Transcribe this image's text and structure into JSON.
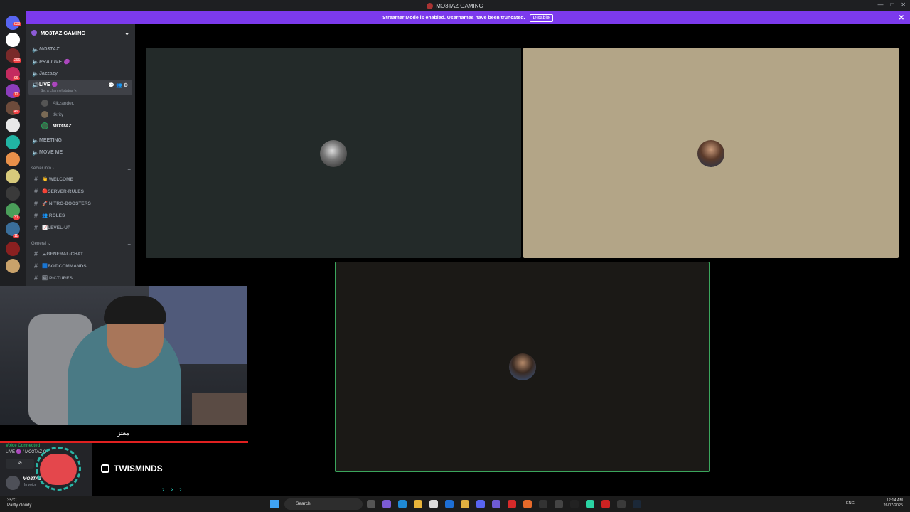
{
  "window": {
    "title": "MO3TAZ GAMING",
    "controls": [
      "—",
      "□",
      "✕"
    ]
  },
  "streamer_banner": {
    "text": "Streamer Mode is enabled. Usernames have been truncated.",
    "button": "Disable",
    "close": "✕"
  },
  "server_rail": {
    "badges": [
      "838",
      "296",
      "96",
      "12",
      "49",
      "31",
      "11"
    ],
    "colors": [
      "#5865f2",
      "#ffffff",
      "#c42b5f",
      "#8b3dbb",
      "#6d4b3b",
      "#e8e8e8",
      "#21b4a4",
      "#e9904a",
      "#d7c97b",
      "#3a3a3a",
      "#4a9e5a",
      "#3a6e9a",
      "#8a2020",
      "#c9a26b"
    ]
  },
  "sidebar": {
    "guild_name": "MO3TAZ GAMING",
    "voice_channels": [
      {
        "label": "MO3TAZ"
      },
      {
        "label": "PRA LIVE 🟣"
      },
      {
        "label": "Jazzazy"
      },
      {
        "label": "LIVE 🟣",
        "status": "Set a channel status ✎"
      },
      {
        "label": "MEETING"
      },
      {
        "label": "MOVE ME"
      }
    ],
    "live_members": [
      "Alkzander.",
      "tlkrity",
      "MO3TAZ"
    ],
    "categories": [
      {
        "label": "server info ›",
        "channels": [
          "👋 WELCOME",
          "🔴SERVER-RULES",
          "🚀 NITRO-BOOSTERS",
          "👥 ROLES",
          "📈LEVEL-UP"
        ]
      },
      {
        "label": "General ⌄",
        "channels": [
          "☁GENERAL-CHAT",
          "🟦BOT-COMMANDS",
          "🖼 PICTURES"
        ]
      }
    ]
  },
  "stage": {
    "tiles": [
      {
        "bg": "#232a29",
        "border": "#232a29"
      },
      {
        "bg": "#b3a587",
        "border": "#b3a587"
      },
      {
        "bg": "#1b1916",
        "border": "#3ba55c"
      }
    ]
  },
  "overlay": {
    "caption": "معتز",
    "social_handle": "TWISMINDS",
    "chevrons": "› › ›"
  },
  "voice_panel": {
    "status": "Voice Connected",
    "channel": "LIVE 🟣 / MO3TAZ G",
    "username": "MO3TAZ",
    "user_status": "In voice"
  },
  "taskbar": {
    "temperature": "35°C",
    "weather": "Partly cloudy",
    "search_placeholder": "Search",
    "language": "ENG",
    "time": "12:14 AM",
    "date": "26/07/2025"
  }
}
